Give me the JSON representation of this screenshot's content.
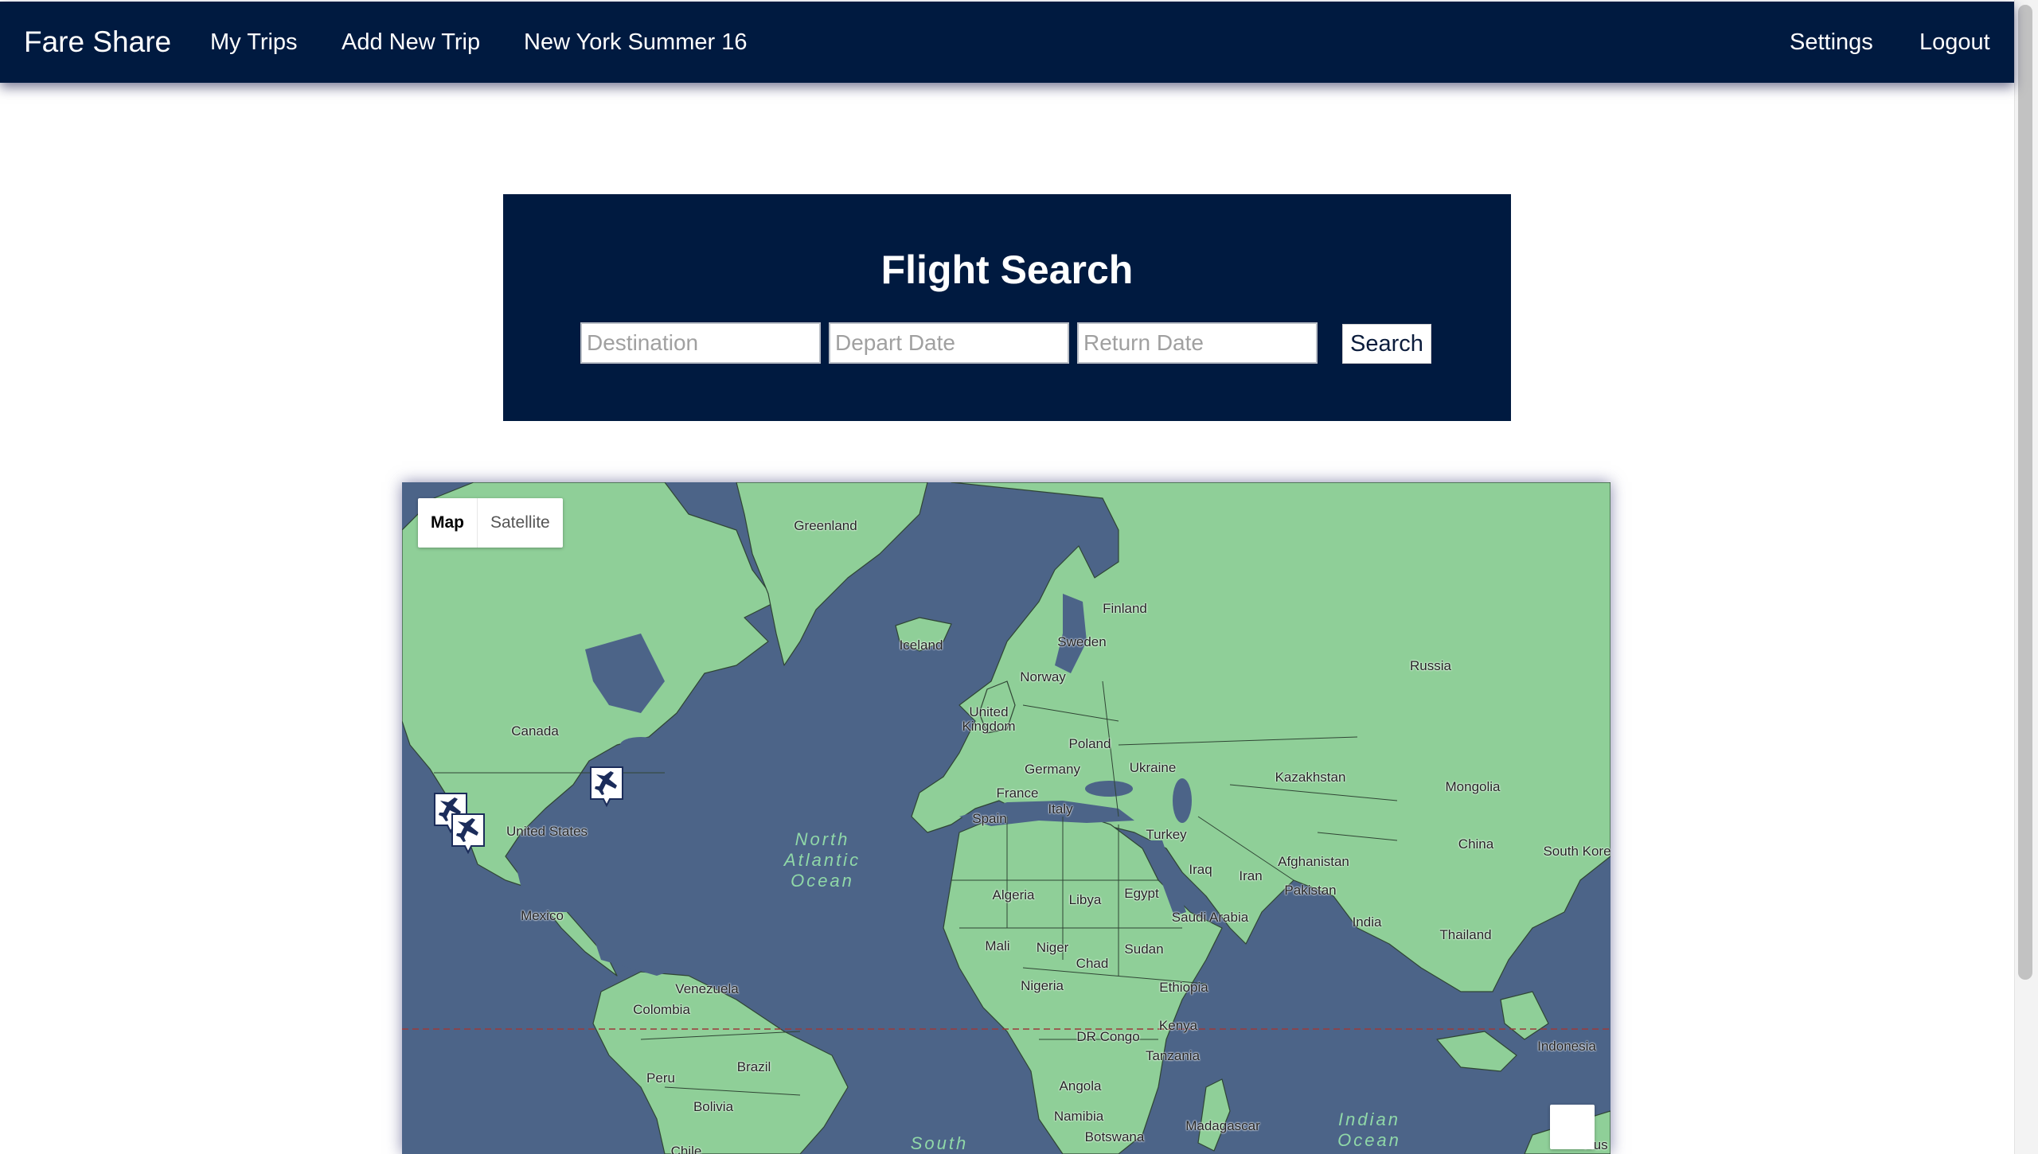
{
  "navbar": {
    "brand": "Fare Share",
    "links": [
      "My Trips",
      "Add New Trip",
      "New York Summer 16"
    ],
    "right_links": [
      "Settings",
      "Logout"
    ],
    "background": "#001a40"
  },
  "search": {
    "title": "Flight Search",
    "destination_placeholder": "Destination",
    "depart_placeholder": "Depart Date",
    "return_placeholder": "Return Date",
    "button_label": "Search"
  },
  "map": {
    "type_control": {
      "map_label": "Map",
      "satellite_label": "Satellite",
      "selected": "Map"
    },
    "colors": {
      "water": "#4c6488",
      "land": "#8fcf98",
      "border": "#2a3a2e",
      "equator": "#9b3a3a"
    },
    "countries": [
      "Greenland",
      "Iceland",
      "Finland",
      "Sweden",
      "Norway",
      "Russia",
      "United Kingdom",
      "Poland",
      "Germany",
      "Ukraine",
      "France",
      "Italy",
      "Spain",
      "Turkey",
      "Kazakhstan",
      "Mongolia",
      "China",
      "South Kore",
      "Canada",
      "United States",
      "Mexico",
      "Iraq",
      "Iran",
      "Afghanistan",
      "Pakistan",
      "India",
      "Thailand",
      "Algeria",
      "Libya",
      "Egypt",
      "Saudi Arabia",
      "Mali",
      "Niger",
      "Chad",
      "Sudan",
      "Nigeria",
      "Ethiopia",
      "Venezuela",
      "Colombia",
      "Kenya",
      "DR Congo",
      "Tanzania",
      "Indonesia",
      "Peru",
      "Brazil",
      "Bolivia",
      "Angola",
      "Namibia",
      "Botswana",
      "Madagascar",
      "Chile",
      "Aus"
    ],
    "oceans": [
      {
        "name": "North\nAtlantic\nOcean"
      },
      {
        "name": "Indian\nOcean"
      },
      {
        "name": "South"
      }
    ],
    "markers": [
      {
        "name": "plane-marker"
      },
      {
        "name": "plane-marker"
      },
      {
        "name": "plane-marker"
      }
    ],
    "marker_icon": "airplane-icon",
    "pegman_icon": "street-view-icon"
  }
}
